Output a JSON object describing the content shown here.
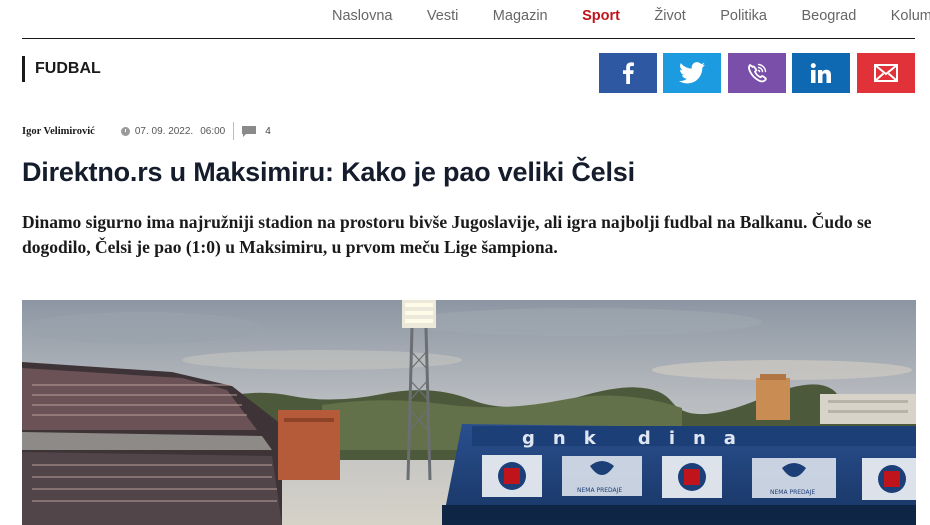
{
  "nav": {
    "items": [
      {
        "label": "Naslovna",
        "active": false
      },
      {
        "label": "Vesti",
        "active": false
      },
      {
        "label": "Magazin",
        "active": false
      },
      {
        "label": "Sport",
        "active": true
      },
      {
        "label": "Život",
        "active": false
      },
      {
        "label": "Politika",
        "active": false
      },
      {
        "label": "Beograd",
        "active": false
      },
      {
        "label": "Kolumne",
        "active": false
      }
    ]
  },
  "category": "FUDBAL",
  "share": {
    "icons": [
      "facebook-icon",
      "twitter-icon",
      "viber-icon",
      "linkedin-icon",
      "mail-icon"
    ],
    "colors": {
      "facebook": "#2f58a3",
      "twitter": "#1c9be0",
      "viber": "#7a4fa9",
      "linkedin": "#0e68b2",
      "mail": "#e13239"
    }
  },
  "meta": {
    "author": "Igor Velimirović",
    "date": "07. 09. 2022.",
    "time": "06:00",
    "comments": "4"
  },
  "article": {
    "title": "Direktno.rs u Maksimiru: Kako je pao veliki Čelsi",
    "lead": "Dinamo sigurno ima najružniji stadion na prostoru bivše Jugoslavije, ali igra najbolji fudbal na Balkanu. Čudo se dogodilo, Čelsi je pao (1:0) u Maksimiru, u prvom meču Lige šampiona."
  },
  "hero": {
    "stand_lettering": "gnk dina",
    "banner_text": "NEMA PREDAJE"
  },
  "colors": {
    "accent": "#c0141c",
    "headline": "#151c2b"
  }
}
